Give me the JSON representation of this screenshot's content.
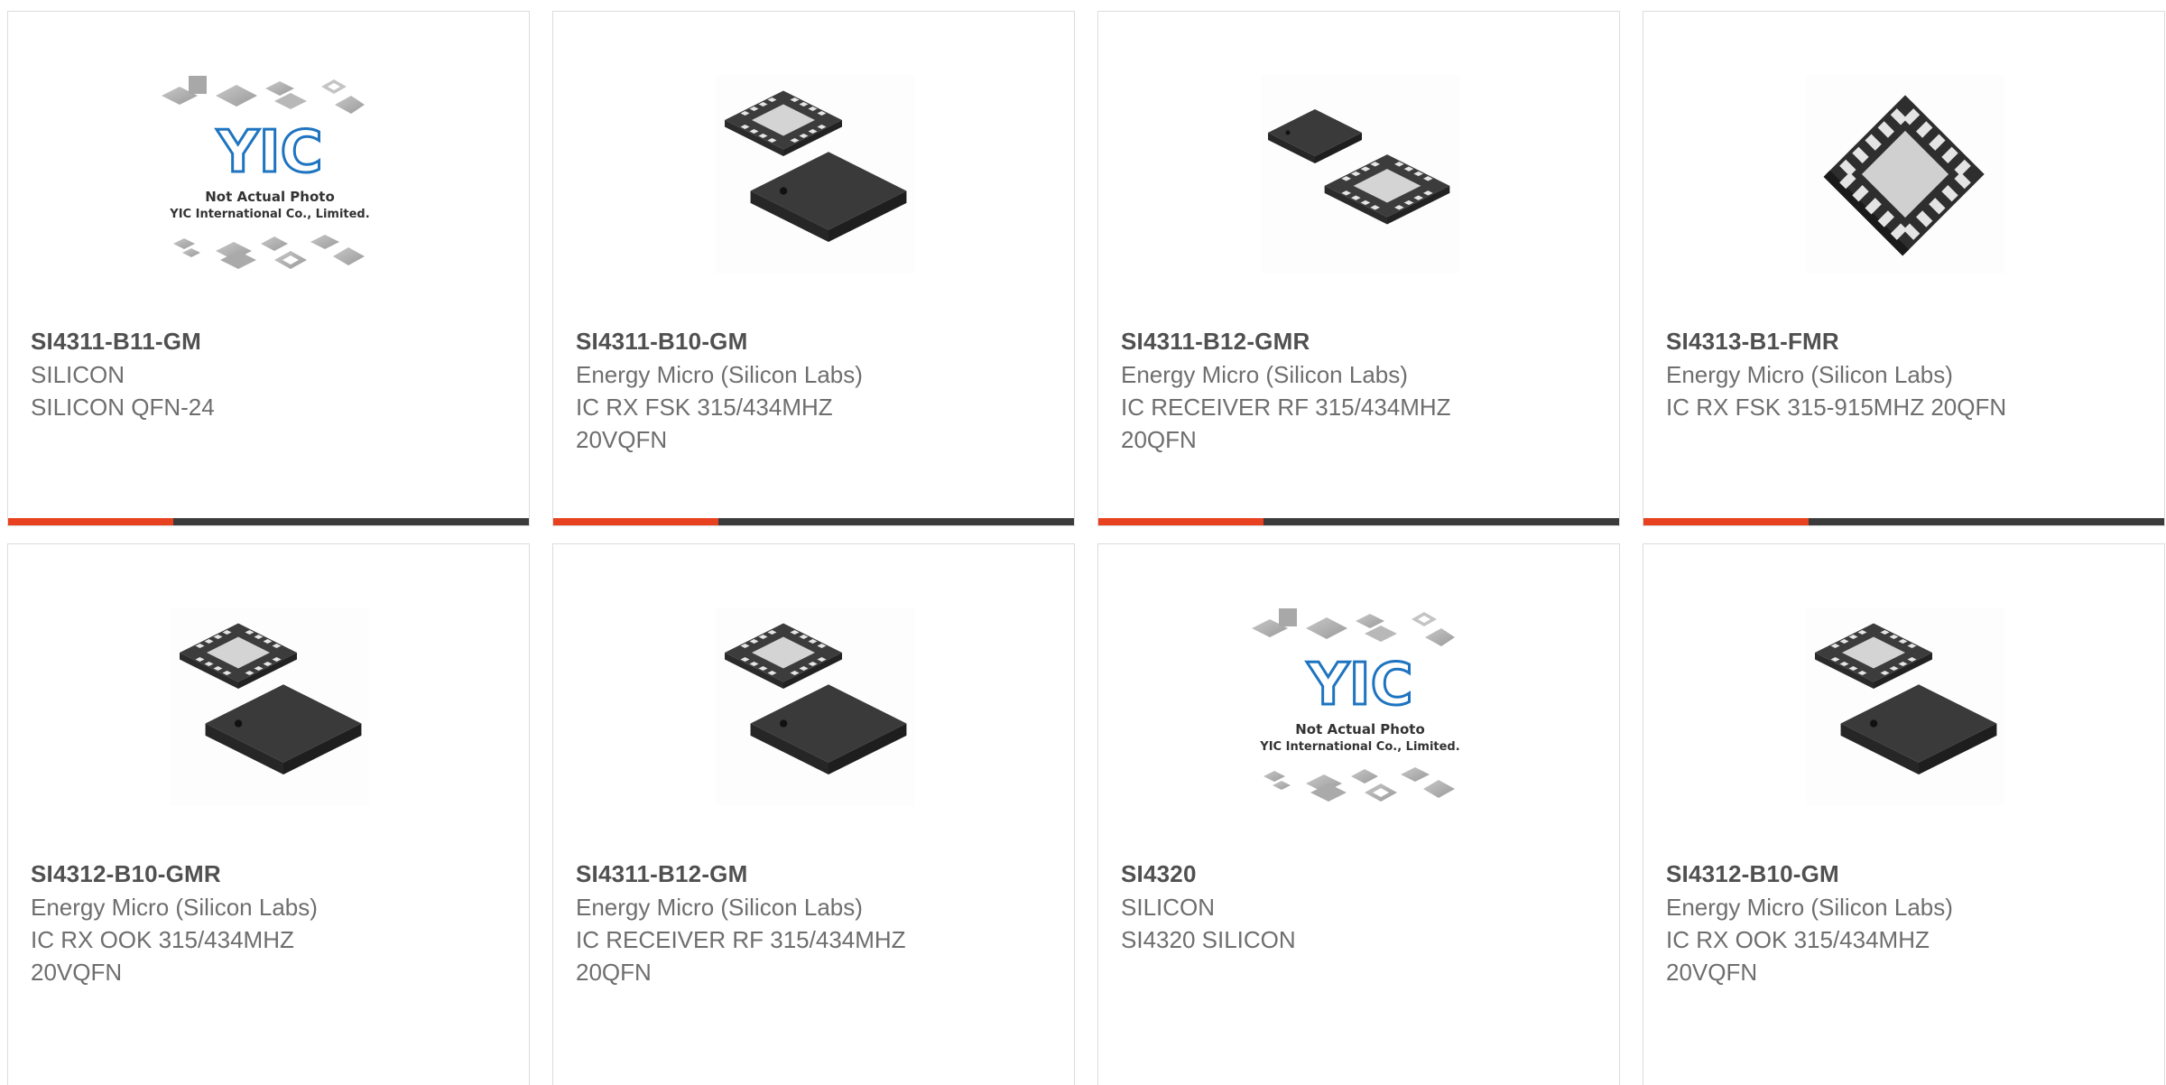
{
  "colors": {
    "accent": "#e8411f",
    "bar": "#3b3b3b",
    "part_number": "#505050",
    "text": "#6e6e6e",
    "border": "#dcdcdc",
    "logo_blue": "#1e74c0"
  },
  "placeholder": {
    "logo": "YIC",
    "line1": "Not Actual Photo",
    "line2": "YIC International Co., Limited."
  },
  "products": [
    {
      "part": "SI4311-B11-GM",
      "maker": "SILICON",
      "desc1": "SILICON QFN-24",
      "desc2": "",
      "image": "placeholder-photo"
    },
    {
      "part": "SI4311-B10-GM",
      "maker": "Energy Micro (Silicon Labs)",
      "desc1": "IC RX FSK 315/434MHZ",
      "desc2": "20VQFN",
      "image": "qfn-chip-top-bottom-icon"
    },
    {
      "part": "SI4311-B12-GMR",
      "maker": "Energy Micro (Silicon Labs)",
      "desc1": "IC RECEIVER RF 315/434MHZ",
      "desc2": "20QFN",
      "image": "qfn-chip-pair-icon"
    },
    {
      "part": "SI4313-B1-FMR",
      "maker": "Energy Micro (Silicon Labs)",
      "desc1": "IC RX FSK 315-915MHZ 20QFN",
      "desc2": "",
      "image": "qfn-chip-single-icon"
    },
    {
      "part": "SI4312-B10-GMR",
      "maker": "Energy Micro (Silicon Labs)",
      "desc1": "IC RX OOK 315/434MHZ",
      "desc2": "20VQFN",
      "image": "qfn-chip-top-bottom-icon"
    },
    {
      "part": "SI4311-B12-GM",
      "maker": "Energy Micro (Silicon Labs)",
      "desc1": "IC RECEIVER RF 315/434MHZ",
      "desc2": "20QFN",
      "image": "qfn-chip-top-bottom-icon"
    },
    {
      "part": "SI4320",
      "maker": "SILICON",
      "desc1": "SI4320 SILICON",
      "desc2": "",
      "image": "placeholder-photo"
    },
    {
      "part": "SI4312-B10-GM",
      "maker": "Energy Micro (Silicon Labs)",
      "desc1": "IC RX OOK 315/434MHZ",
      "desc2": "20VQFN",
      "image": "qfn-chip-top-bottom-icon"
    }
  ]
}
